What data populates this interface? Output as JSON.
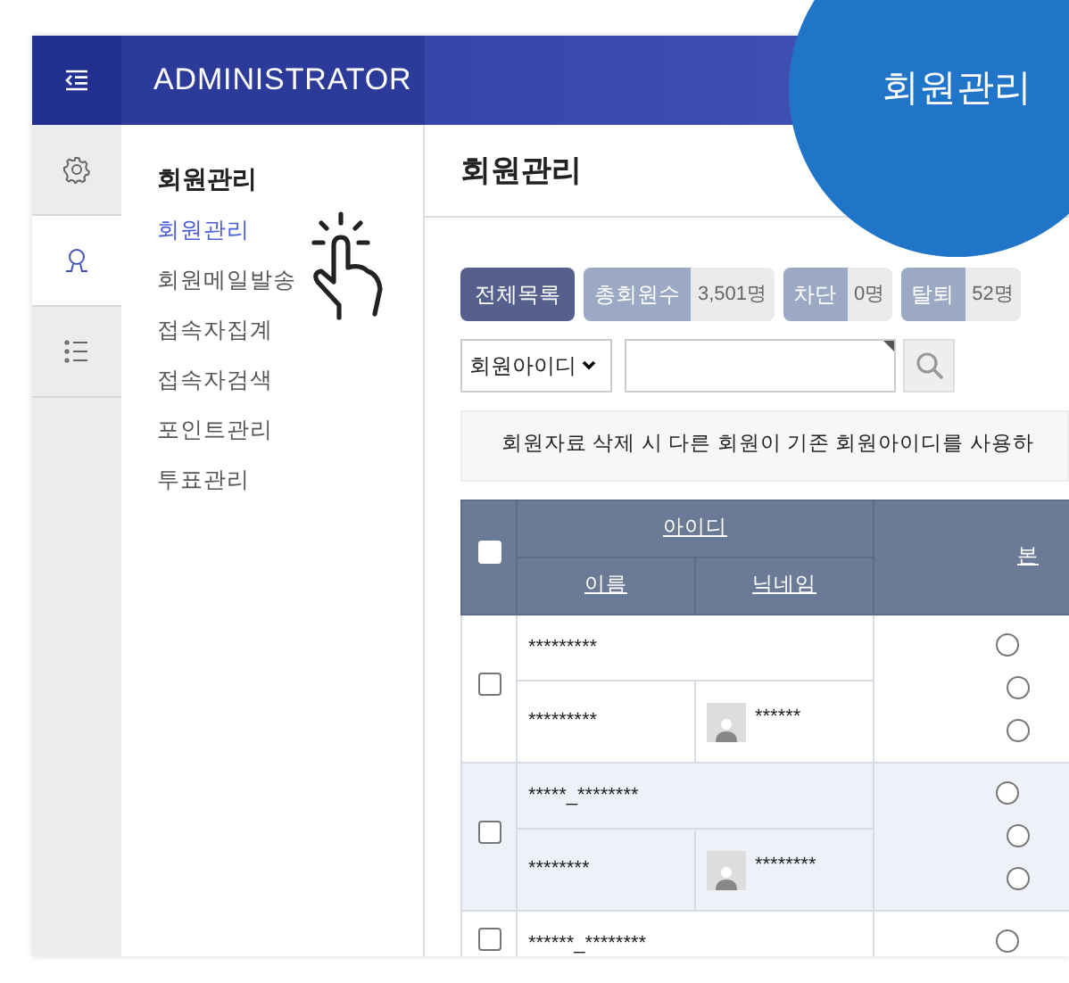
{
  "header": {
    "title": "ADMINISTRATOR"
  },
  "rail": [
    {
      "kind": "settings",
      "selected": false
    },
    {
      "kind": "user",
      "selected": true
    },
    {
      "kind": "list",
      "selected": false
    }
  ],
  "callout": {
    "label": "회원관리"
  },
  "menu": {
    "title": "회원관리",
    "items": [
      {
        "label": "회원관리",
        "selected": true
      },
      {
        "label": "회원메일발송",
        "selected": false
      },
      {
        "label": "접속자집계",
        "selected": false
      },
      {
        "label": "접속자검색",
        "selected": false
      },
      {
        "label": "포인트관리",
        "selected": false
      },
      {
        "label": "투표관리",
        "selected": false
      }
    ]
  },
  "page_title": "회원관리",
  "filters": [
    {
      "kind": "button",
      "label": "전체목록"
    },
    {
      "kind": "stat",
      "label": "총회원수",
      "count": "3,501명"
    },
    {
      "kind": "stat",
      "label": "차단",
      "count": "0명"
    },
    {
      "kind": "stat",
      "label": "탈퇴",
      "count": "52명"
    }
  ],
  "search": {
    "field": "회원아이디"
  },
  "notice": "회원자료 삭제 시 다른 회원이 기존 회원아이디를 사용하",
  "table": {
    "columns": {
      "id": "아이디",
      "name": "이름",
      "nickname": "닉네임",
      "column_4": "본"
    },
    "header_checked": false,
    "rows": [
      {
        "id": "*********",
        "name": "*********",
        "nickname": "******",
        "checked": false,
        "radios": [
          {
            "selected": false
          },
          {
            "selected": false
          },
          {
            "selected": false
          }
        ]
      },
      {
        "id": "*****_********",
        "name": "********",
        "nickname": "********",
        "checked": false,
        "radios": [
          {
            "selected": false
          },
          {
            "selected": false
          },
          {
            "selected": false
          }
        ]
      },
      {
        "id": "******_********",
        "checked": false,
        "radios": [
          {
            "selected": false
          }
        ]
      }
    ]
  }
}
